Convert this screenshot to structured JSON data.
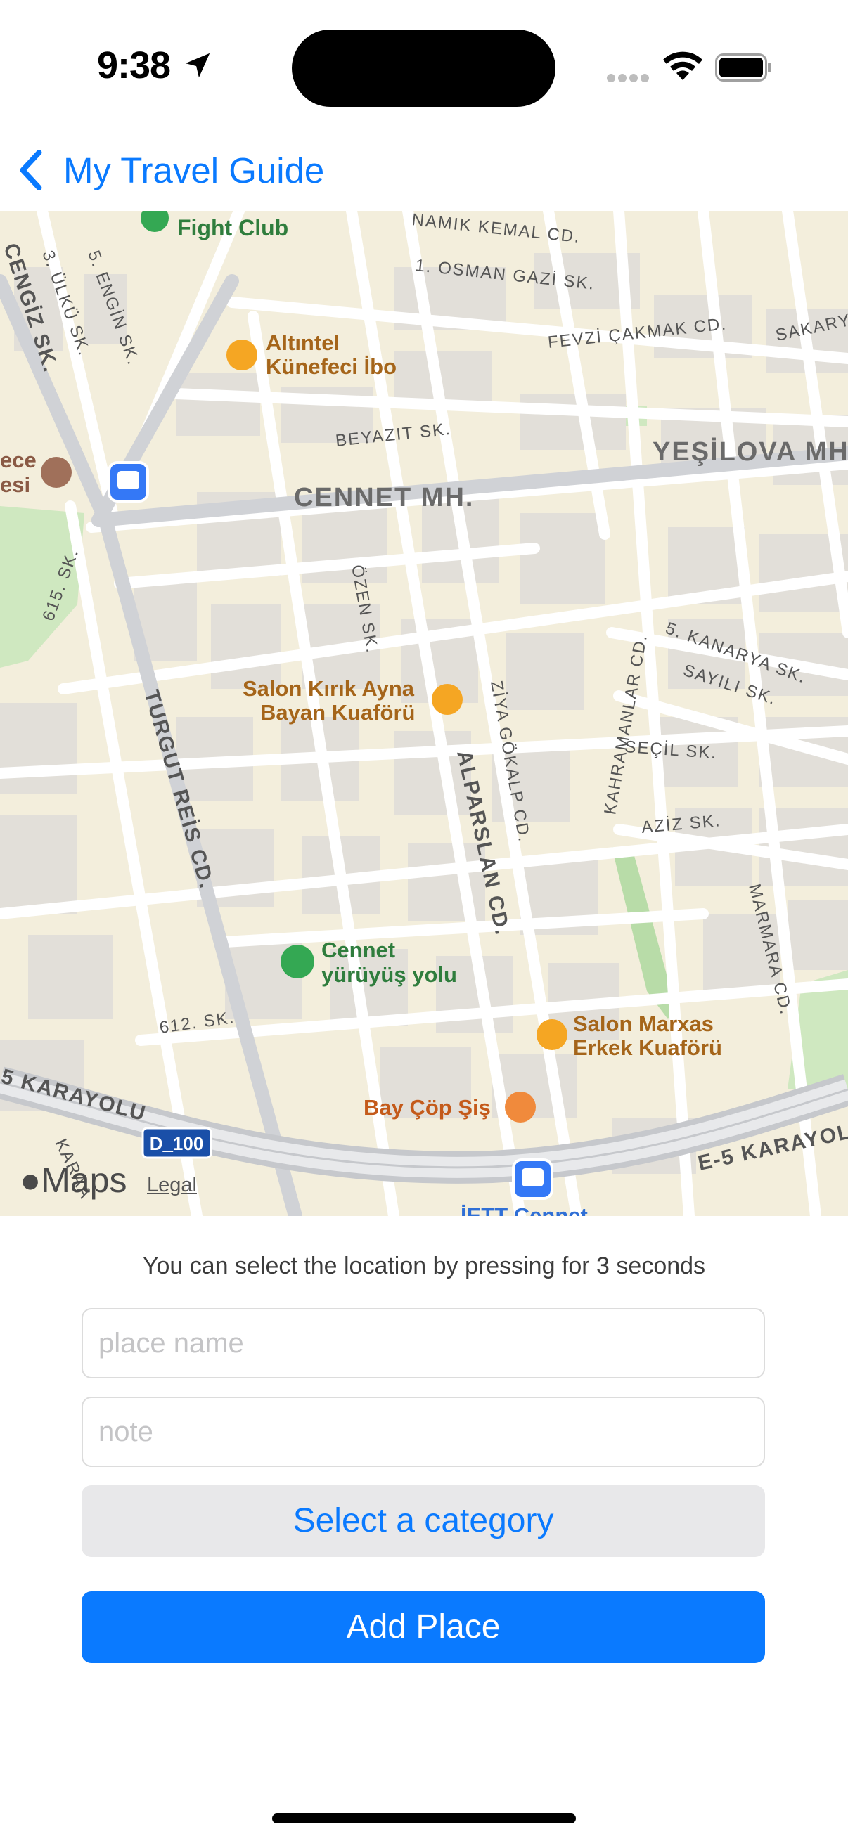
{
  "status_bar": {
    "time": "9:38"
  },
  "nav": {
    "back_label": "My Travel Guide"
  },
  "map": {
    "labels": {
      "fight_club": "Fight Club",
      "namik_kemal": "NAMIK KEMAL CD.",
      "osman_gazi": "1. OSMAN GAZİ SK.",
      "cengiz": "CENGİZ SK.",
      "ulku": "3. ÜLKÜ SK.",
      "engin": "5. ENGİN SK.",
      "altintel_1": "Altıntel",
      "altintel_2": "Künefeci İbo",
      "fevzi": "FEVZİ ÇAKMAK CD.",
      "sakary": "SAKARY",
      "beyazit": "BEYAZIT SK.",
      "yesilova": "YEŞİLOVA MH.",
      "cennet_mh": "CENNET MH.",
      "ece": "ece",
      "esi": "esi",
      "s615": "615. SK.",
      "ozen": "ÖZEN SK.",
      "kanarya": "5. KANARYA SK.",
      "sayili": "SAYILI SK.",
      "secil": "SEÇİL SK.",
      "aziz": "AZİZ SK.",
      "kahramanlar": "KAHRAMANLAR CD.",
      "ziya": "ZİYA GÖKALP CD.",
      "alparslan": "ALPARSLAN CD.",
      "turgut": "TURGUT REİS CD.",
      "salon_kirik_1": "Salon Kırık Ayna",
      "salon_kirik_2": "Bayan Kuaförü",
      "marmara": "MARMARA CD.",
      "cennet_yuruyus_1": "Cennet",
      "cennet_yuruyus_2": "yürüyüş yolu",
      "s612": "612. SK.",
      "salon_marxas_1": "Salon Marxas",
      "salon_marxas_2": "Erkek Kuaförü",
      "karayolu_left": "5 KARAYOLU",
      "bay_cop": "Bay Çöp Şiş",
      "d100": "D_100",
      "karayolu_right": "E-5 KARAYOL",
      "karaa": "KARAA",
      "iett": "İETT Cennet",
      "maps_logo": "Maps",
      "legal": "Legal"
    }
  },
  "form": {
    "hint": "You can select the location by pressing for 3 seconds",
    "place_name_placeholder": "place name",
    "note_placeholder": "note",
    "category_button": "Select a category",
    "add_button": "Add Place"
  },
  "colors": {
    "accent": "#0a7aff",
    "map_land": "#f3eedc",
    "map_road": "#ffffff",
    "map_block": "#e4e2dd",
    "park": "#cfe8c0",
    "poi_orange": "#f5a623",
    "poi_green": "#34a853",
    "transit": "#3478f6"
  }
}
